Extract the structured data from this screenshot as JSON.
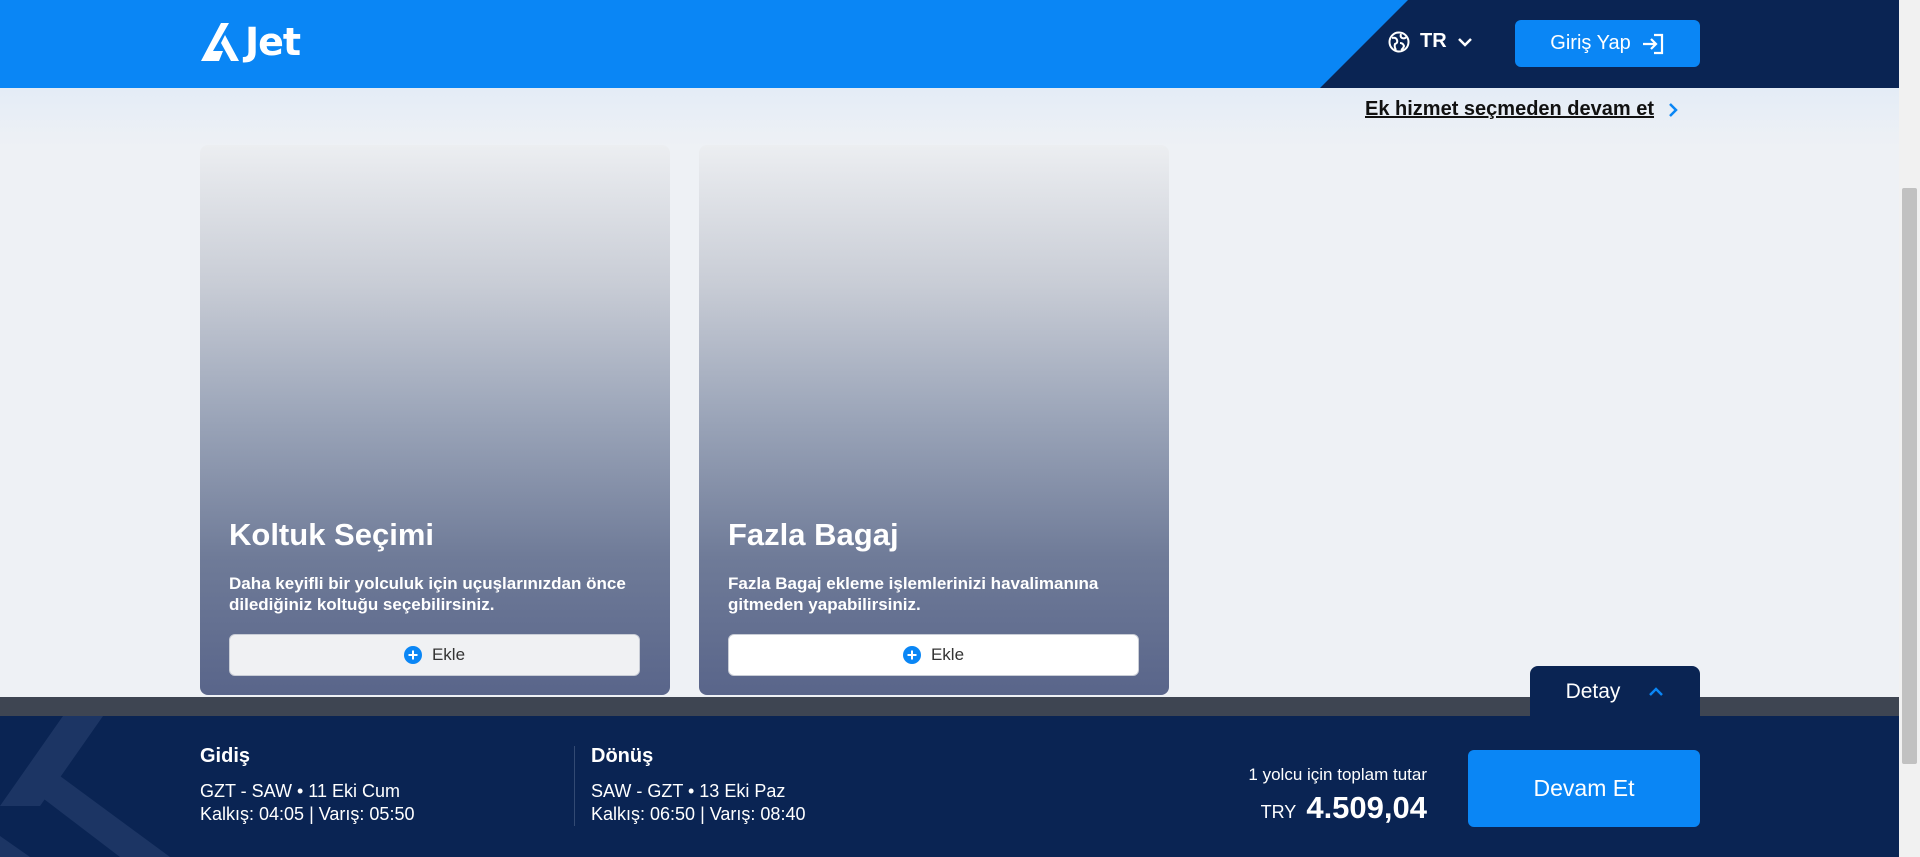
{
  "header": {
    "logo_text": "Jet",
    "language": "TR",
    "login_label": "Giriş Yap"
  },
  "skip_link": "Ek hizmet seçmeden devam et",
  "cards": [
    {
      "title": "Koltuk Seçimi",
      "description": "Daha keyifli bir yolculuk için uçuşlarınızdan önce dilediğiniz koltuğu seçebilirsiniz.",
      "button_label": "Ekle"
    },
    {
      "title": "Fazla Bagaj",
      "description": "Fazla Bagaj ekleme işlemlerinizi havalimanına gitmeden yapabilirsiniz.",
      "button_label": "Ekle"
    }
  ],
  "detail_label": "Detay",
  "footer": {
    "outbound": {
      "title": "Gidiş",
      "route": "GZT - SAW • 11 Eki Cum",
      "times": "Kalkış: 04:05 | Varış: 05:50"
    },
    "return": {
      "title": "Dönüş",
      "route": "SAW - GZT • 13 Eki Paz",
      "times": "Kalkış: 06:50 | Varış: 08:40"
    },
    "total_label": "1 yolcu için toplam tutar",
    "currency": "TRY",
    "total": "4.509,04",
    "continue_label": "Devam Et"
  },
  "colors": {
    "brand_blue": "#0a86f5",
    "navy": "#0a2453"
  }
}
